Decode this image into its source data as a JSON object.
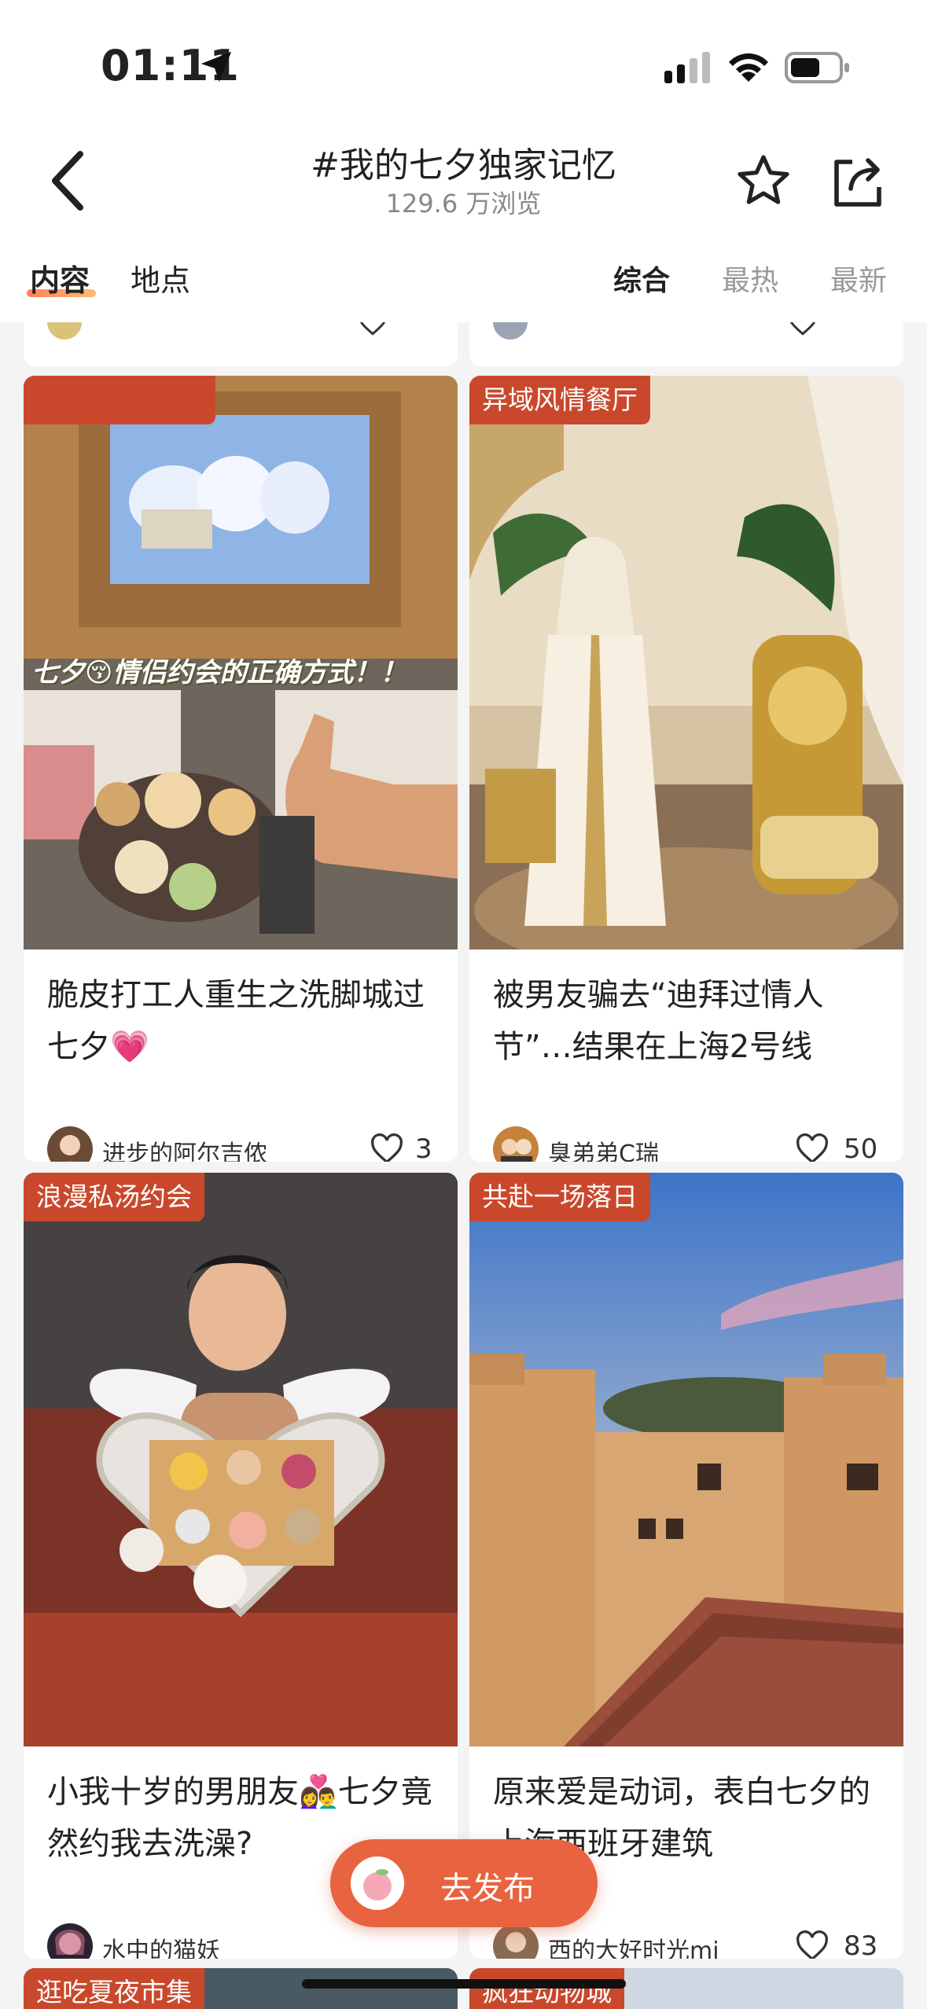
{
  "status_bar": {
    "time": "01:11"
  },
  "header": {
    "title": "#我的七夕独家记忆",
    "subtitle": "129.6 万浏览"
  },
  "tabs": {
    "content": "内容",
    "place": "地点",
    "sort_all": "综合",
    "sort_hot": "最热",
    "sort_new": "最新"
  },
  "cards": [
    {
      "tag": "",
      "image_caption": "七夕😚情侣约会的正确方式！！",
      "title": "脆皮打工人重生之洗脚城过七夕💗",
      "author": "进步的阿尔吉侬",
      "likes": "3"
    },
    {
      "tag": "异域风情餐厅",
      "title": "被男友骗去“迪拜过情人节”…结果在上海2号线",
      "author": "臭弟弟C瑞",
      "likes": "50"
    },
    {
      "tag": "浪漫私汤约会",
      "title": "小我十岁的男朋友👩‍❤️‍👨七夕竟然约我去洗澡?",
      "author": "水中的猫妖",
      "likes": ""
    },
    {
      "tag": "共赴一场落日",
      "title": "原来爱是动词，表白七夕的上海西班牙建筑",
      "author": "西的大好时光mi",
      "likes": "83"
    }
  ],
  "bottom_tags": [
    "逛吃夏夜市集",
    "疯狂动物城"
  ],
  "publish": {
    "label": "去发布"
  },
  "colors": {
    "accent": "#e8633f",
    "tag": "#c9482c"
  }
}
